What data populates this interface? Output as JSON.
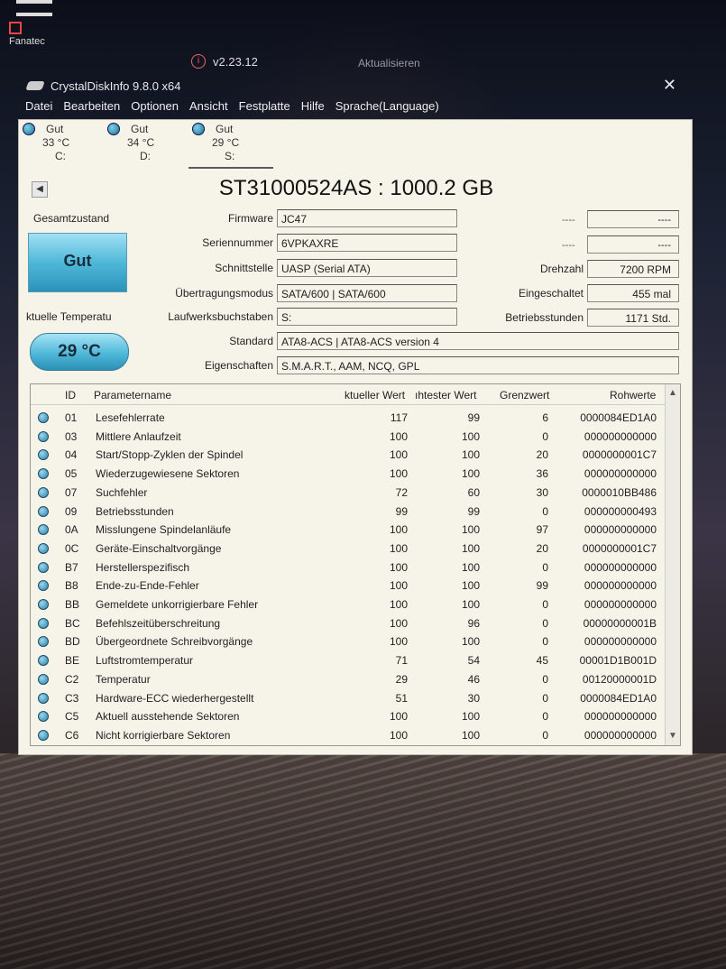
{
  "desktop": {
    "icon_label": "Fanatec",
    "fanatec_version": "v2.23.12",
    "refresh_label": "Aktualisieren"
  },
  "window": {
    "title": "CrystalDiskInfo 9.8.0 x64",
    "close_glyph": "✕"
  },
  "menu": [
    "Datei",
    "Bearbeiten",
    "Optionen",
    "Ansicht",
    "Festplatte",
    "Hilfe",
    "Sprache(Language)"
  ],
  "drives": [
    {
      "status": "Gut",
      "temp": "33 °C",
      "letter": "C:"
    },
    {
      "status": "Gut",
      "temp": "34 °C",
      "letter": "D:"
    },
    {
      "status": "Gut",
      "temp": "29 °C",
      "letter": "S:"
    }
  ],
  "model": "ST31000524AS : 1000.2 GB",
  "health": {
    "label": "Gesamtzustand",
    "value": "Gut"
  },
  "temperature": {
    "label": "ktuelle Temperatu",
    "value": "29 °C"
  },
  "info": {
    "firmware_label": "Firmware",
    "firmware": "JC47",
    "serial_label": "Seriennummer",
    "serial": "6VPKAXRE",
    "interface_label": "Schnittstelle",
    "interface": "UASP (Serial ATA)",
    "transfer_label": "Übertragungsmodus",
    "transfer": "SATA/600 | SATA/600",
    "letters_label": "Laufwerksbuchstaben",
    "letters": "S:",
    "standard_label": "Standard",
    "standard": "ATA8-ACS | ATA8-ACS version 4",
    "features_label": "Eigenschaften",
    "features": "S.M.A.R.T., AAM, NCQ, GPL",
    "dash_label": "----",
    "dash_value": "----",
    "rpm_label": "Drehzahl",
    "rpm": "7200 RPM",
    "power_on_count_label": "Eingeschaltet",
    "power_on_count": "455 mal",
    "power_on_hours_label": "Betriebsstunden",
    "power_on_hours": "1171 Std."
  },
  "smart": {
    "headers": {
      "id": "ID",
      "name": "Parametername",
      "current": "ktueller Wert",
      "worst": "ıhtester Wert",
      "threshold": "Grenzwert",
      "raw": "Rohwerte"
    },
    "rows": [
      {
        "id": "01",
        "name": "Lesefehlerrate",
        "current": "117",
        "worst": "99",
        "threshold": "6",
        "raw": "0000084ED1A0"
      },
      {
        "id": "03",
        "name": "Mittlere Anlaufzeit",
        "current": "100",
        "worst": "100",
        "threshold": "0",
        "raw": "000000000000"
      },
      {
        "id": "04",
        "name": "Start/Stopp-Zyklen der Spindel",
        "current": "100",
        "worst": "100",
        "threshold": "20",
        "raw": "0000000001C7"
      },
      {
        "id": "05",
        "name": "Wiederzugewiesene Sektoren",
        "current": "100",
        "worst": "100",
        "threshold": "36",
        "raw": "000000000000"
      },
      {
        "id": "07",
        "name": "Suchfehler",
        "current": "72",
        "worst": "60",
        "threshold": "30",
        "raw": "0000010BB486"
      },
      {
        "id": "09",
        "name": "Betriebsstunden",
        "current": "99",
        "worst": "99",
        "threshold": "0",
        "raw": "000000000493"
      },
      {
        "id": "0A",
        "name": "Misslungene Spindelanläufe",
        "current": "100",
        "worst": "100",
        "threshold": "97",
        "raw": "000000000000"
      },
      {
        "id": "0C",
        "name": "Geräte-Einschaltvorgänge",
        "current": "100",
        "worst": "100",
        "threshold": "20",
        "raw": "0000000001C7"
      },
      {
        "id": "B7",
        "name": "Herstellerspezifisch",
        "current": "100",
        "worst": "100",
        "threshold": "0",
        "raw": "000000000000"
      },
      {
        "id": "B8",
        "name": "Ende-zu-Ende-Fehler",
        "current": "100",
        "worst": "100",
        "threshold": "99",
        "raw": "000000000000"
      },
      {
        "id": "BB",
        "name": "Gemeldete unkorrigierbare Fehler",
        "current": "100",
        "worst": "100",
        "threshold": "0",
        "raw": "000000000000"
      },
      {
        "id": "BC",
        "name": "Befehlszeitüberschreitung",
        "current": "100",
        "worst": "96",
        "threshold": "0",
        "raw": "00000000001B"
      },
      {
        "id": "BD",
        "name": "Übergeordnete Schreibvorgänge",
        "current": "100",
        "worst": "100",
        "threshold": "0",
        "raw": "000000000000"
      },
      {
        "id": "BE",
        "name": "Luftstromtemperatur",
        "current": "71",
        "worst": "54",
        "threshold": "45",
        "raw": "00001D1B001D"
      },
      {
        "id": "C2",
        "name": "Temperatur",
        "current": "29",
        "worst": "46",
        "threshold": "0",
        "raw": "00120000001D"
      },
      {
        "id": "C3",
        "name": "Hardware-ECC wiederhergestellt",
        "current": "51",
        "worst": "30",
        "threshold": "0",
        "raw": "0000084ED1A0"
      },
      {
        "id": "C5",
        "name": "Aktuell ausstehende Sektoren",
        "current": "100",
        "worst": "100",
        "threshold": "0",
        "raw": "000000000000"
      },
      {
        "id": "C6",
        "name": "Nicht korrigierbare Sektoren",
        "current": "100",
        "worst": "100",
        "threshold": "0",
        "raw": "000000000000"
      }
    ]
  }
}
